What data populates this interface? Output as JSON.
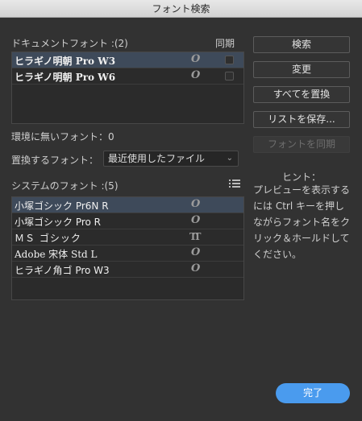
{
  "window": {
    "title": "フォント検索"
  },
  "document_fonts": {
    "header": "ドキュメントフォント :(2)",
    "sync_header": "同期",
    "items": [
      {
        "name": "ヒラギノ明朝 Pro W3",
        "type_icon": "opentype-icon",
        "selected": true,
        "synced": false
      },
      {
        "name": "ヒラギノ明朝 Pro W6",
        "type_icon": "opentype-icon",
        "selected": false,
        "synced": false
      }
    ]
  },
  "missing_fonts": {
    "label": "環境に無いフォント：0"
  },
  "replace": {
    "label": "置換するフォント：",
    "selected": "最近使用したファイル"
  },
  "system_fonts": {
    "header": "システムのフォント :(5)",
    "items": [
      {
        "name": "小塚ゴシック Pr6N R",
        "type_icon": "opentype-icon",
        "selected": true
      },
      {
        "name": "小塚ゴシック Pro R",
        "type_icon": "opentype-icon",
        "selected": false
      },
      {
        "name": "ＭＳ ゴシック",
        "type_icon": "truetype-icon",
        "selected": false
      },
      {
        "name": "Adobe 宋体 Std L",
        "type_icon": "opentype-icon",
        "selected": false
      },
      {
        "name": "ヒラギノ角ゴ Pro W3",
        "type_icon": "opentype-icon",
        "selected": false
      }
    ]
  },
  "buttons": {
    "search": "検索",
    "change": "変更",
    "replace_all": "すべてを置換",
    "save_list": "リストを保存...",
    "sync_fonts": "フォントを同期",
    "done": "完了"
  },
  "hint": {
    "title": "ヒント：",
    "body": "プレビューを表示するには Ctrl キーを押しながらフォント名をクリック＆ホールドしてください。"
  },
  "colors": {
    "accent": "#4a9bee",
    "selection": "#3e4a5a",
    "background": "#323232"
  }
}
